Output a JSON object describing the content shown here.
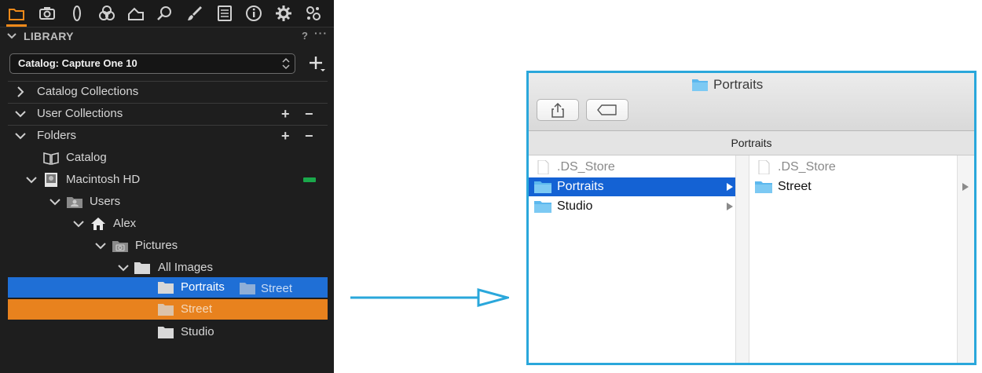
{
  "colors": {
    "panel_bg": "#1e1e1e",
    "accent_orange": "#f08a1a",
    "selection_blue": "#1f6fd6",
    "selection_orange": "#e8821e",
    "finder_border": "#2aa7db",
    "finder_selection": "#1462d4",
    "indicator_green": "#1aa84b",
    "folder_blue": "#5cb8ee"
  },
  "toolbar": {
    "icons": [
      "folder-icon",
      "camera-icon",
      "lens-icon",
      "color-circles-icon",
      "exposure-icon",
      "magnifier-icon",
      "brush-icon",
      "list-icon",
      "info-icon",
      "gear-icon",
      "settings-icon"
    ]
  },
  "library": {
    "title": "LIBRARY",
    "help": "?",
    "more": "···",
    "catalog_select": "Catalog: Capture One 10",
    "collections": {
      "catalog_collections": "Catalog Collections",
      "user_collections": "User Collections",
      "folders": "Folders"
    },
    "tree": {
      "catalog": "Catalog",
      "macintosh_hd": "Macintosh HD",
      "users": "Users",
      "alex": "Alex",
      "pictures": "Pictures",
      "all_images": "All Images",
      "portraits": "Portraits",
      "drag_ghost": "Street",
      "street": "Street",
      "studio": "Studio"
    },
    "plus": "+",
    "minus": "−"
  },
  "finder": {
    "title": "Portraits",
    "path_label": "Portraits",
    "column1": [
      {
        "name": ".DS_Store",
        "kind": "file"
      },
      {
        "name": "Portraits",
        "kind": "folder",
        "selected": true
      },
      {
        "name": "Studio",
        "kind": "folder"
      }
    ],
    "column2": [
      {
        "name": ".DS_Store",
        "kind": "file"
      },
      {
        "name": "Street",
        "kind": "folder"
      }
    ]
  }
}
